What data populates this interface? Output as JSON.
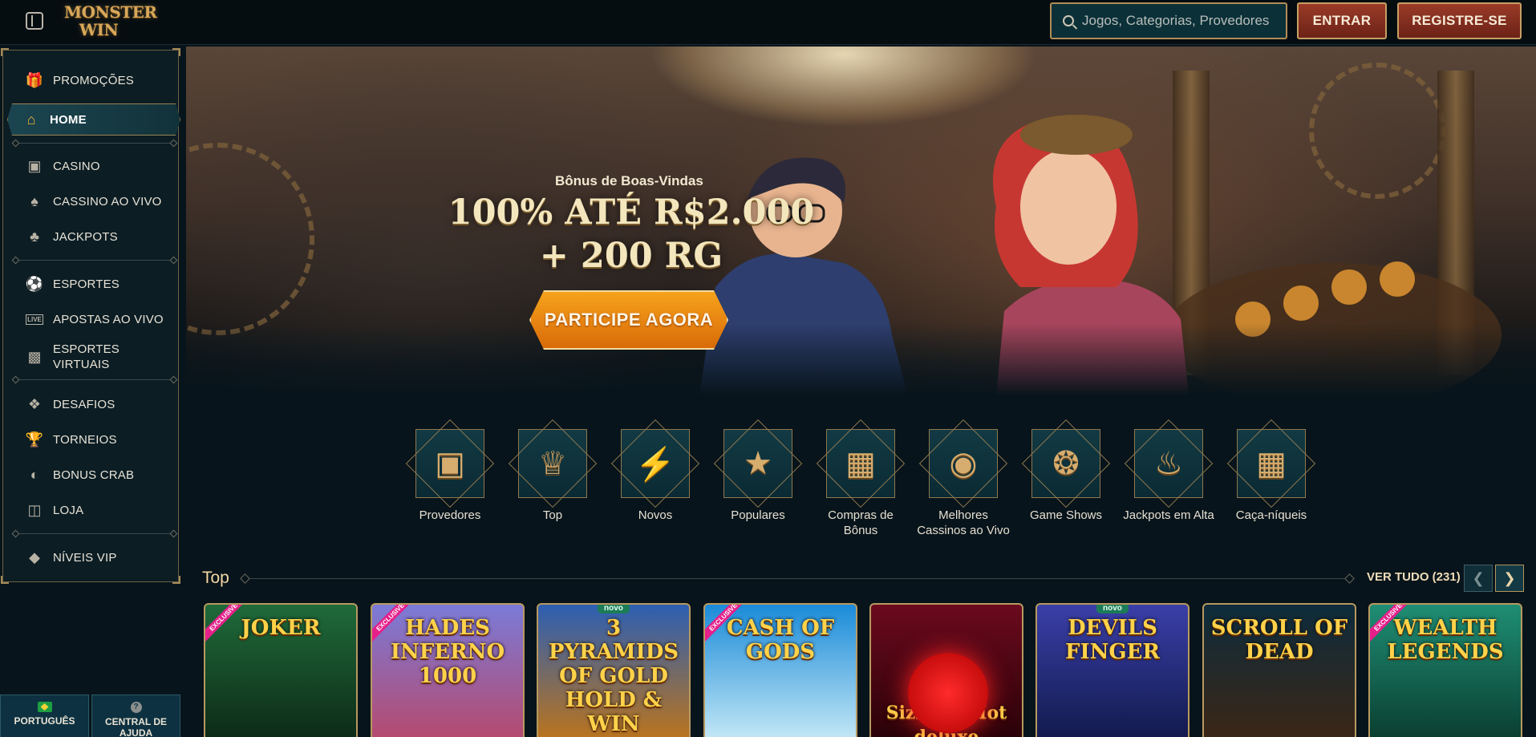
{
  "header": {
    "logo_line1": "MONSTER",
    "logo_line2": "WIN",
    "search_placeholder": "Jogos, Categorias, Provedores",
    "login_label": "ENTRAR",
    "register_label": "REGISTRE-SE"
  },
  "sidebar": {
    "items": [
      {
        "label": "PROMOÇÕES",
        "icon": "gift-icon"
      },
      {
        "label": "HOME",
        "icon": "home-icon",
        "active": true
      },
      {
        "label": "CASINO",
        "icon": "slot-machine-icon"
      },
      {
        "label": "CASSINO AO VIVO",
        "icon": "cards-icon"
      },
      {
        "label": "JACKPOTS",
        "icon": "clover-icon"
      },
      {
        "label": "ESPORTES",
        "icon": "ball-icon"
      },
      {
        "label": "APOSTAS AO VIVO",
        "icon": "live-icon"
      },
      {
        "label": "ESPORTES VIRTUAIS",
        "icon": "virtual-sports-icon"
      },
      {
        "label": "DESAFIOS",
        "icon": "challenge-icon"
      },
      {
        "label": "TORNEIOS",
        "icon": "trophy-icon"
      },
      {
        "label": "BONUS CRAB",
        "icon": "crab-icon"
      },
      {
        "label": "LOJA",
        "icon": "shop-bag-icon"
      },
      {
        "label": "NÍVEIS VIP",
        "icon": "diamond-icon"
      }
    ],
    "language_label": "PORTUGUÊS",
    "help_label": "CENTRAL DE AJUDA"
  },
  "hero": {
    "subtitle": "Bônus de Boas-Vindas",
    "title": "100% ATÉ R$2.000 + 200 RG",
    "cta_label": "PARTICIPE AGORA"
  },
  "categories": [
    {
      "label": "Provedores",
      "icon": "book-icon"
    },
    {
      "label": "Top",
      "icon": "crown-icon"
    },
    {
      "label": "Novos",
      "icon": "lightning-icon"
    },
    {
      "label": "Populares",
      "icon": "star-icon"
    },
    {
      "label": "Compras de Bônus",
      "icon": "chest-icon"
    },
    {
      "label": "Melhores Cassinos ao Vivo",
      "icon": "chip-icon"
    },
    {
      "label": "Game Shows",
      "icon": "wheel-icon"
    },
    {
      "label": "Jackpots em Alta",
      "icon": "flame-icon"
    },
    {
      "label": "Caça-níqueis",
      "icon": "slot-icon"
    }
  ],
  "top_section": {
    "title": "Top",
    "see_all_label": "VER TUDO (231)",
    "games": [
      {
        "title": "JOKER",
        "badge": "EXCLUSIVE",
        "bg1": "#1f6a3a",
        "bg2": "#0d2b17"
      },
      {
        "title": "HADES INFERNO 1000",
        "badge": "EXCLUSIVE",
        "bg1": "#7b7bd8",
        "bg2": "#b54a6f"
      },
      {
        "title": "3 PYRAMIDS OF GOLD HOLD & WIN",
        "badge_new": "novo",
        "bg1": "#2c5fb3",
        "bg2": "#b9741e"
      },
      {
        "title": "CASH OF GODS",
        "badge": "EXCLUSIVE",
        "bg1": "#1a8bd9",
        "bg2": "#c1e6f5"
      },
      {
        "title": "Sizzling Hot deluxe",
        "bg1": "#6b0a1e",
        "bg2": "#2a0208"
      },
      {
        "title": "DEVILS FINGER",
        "badge_new": "novo",
        "bg1": "#3a3fa8",
        "bg2": "#121a4d"
      },
      {
        "title": "SCROLL OF DEAD",
        "bg1": "#0d2c3c",
        "bg2": "#3b2616"
      },
      {
        "title": "WEALTH LEGENDS",
        "badge": "EXCLUSIVE",
        "bg1": "#1f8e74",
        "bg2": "#0a3f31"
      }
    ]
  },
  "colors": {
    "background": "#08141b",
    "accent_gold": "#b7995f",
    "button_red": "#9a3b27",
    "cta_orange": "#f6a21c"
  }
}
